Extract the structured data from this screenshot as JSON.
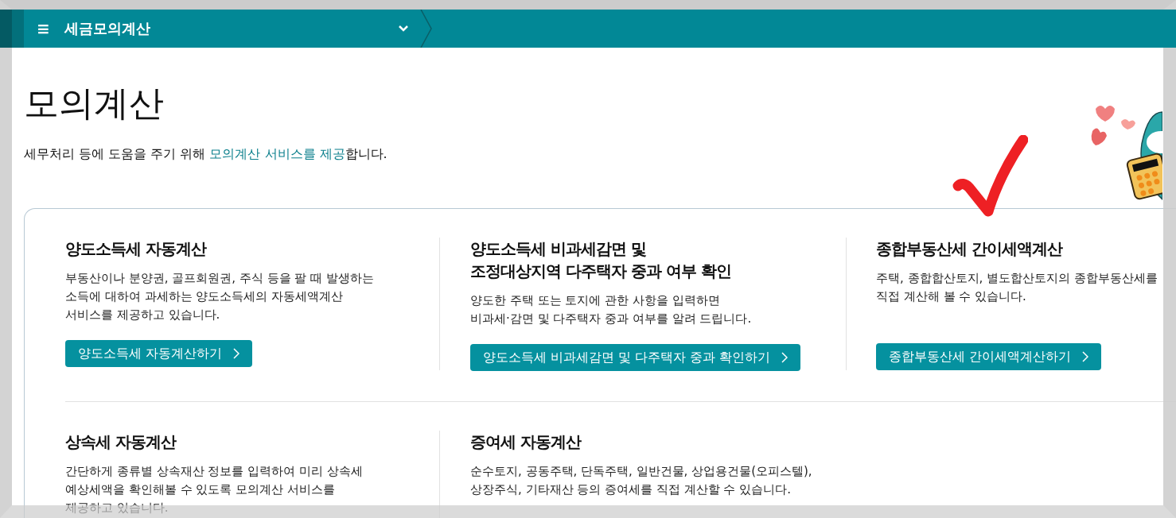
{
  "nav": {
    "menu_icon": "≡",
    "title": "세금모의계산"
  },
  "page": {
    "title": "모의계산",
    "intro": {
      "before": "세무처리 등에 도움을 주기 위해 ",
      "link": "모의계산 서비스를 제공",
      "after": "합니다."
    }
  },
  "services": [
    {
      "title": "양도소득세 자동계산",
      "description": "부동산이나 분양권, 골프회원권, 주식 등을 팔 때 발생하는\n소득에 대하여 과세하는 양도소득세의 자동세액계산\n서비스를 제공하고 있습니다.",
      "button": "양도소득세 자동계산하기"
    },
    {
      "title": "양도소득세 비과세감면 및\n조정대상지역 다주택자 중과 여부 확인",
      "description": "양도한 주택 또는 토지에 관한 사항을 입력하면\n비과세·감면 및 다주택자 중과 여부를 알려 드립니다.",
      "button": "양도소득세 비과세감면 및 다주택자 중과 확인하기"
    },
    {
      "title": "종합부동산세 간이세액계산",
      "description": "주택, 종합합산토지, 별도합산토지의 종합부동산세를 직접 계산해 볼 수 있습니다.",
      "button": "종합부동산세 간이세액계산하기"
    },
    {
      "title": "상속세 자동계산",
      "description": "간단하게 종류별 상속재산 정보를 입력하여 미리 상속세\n예상세액을 확인해볼 수 있도록 모의계산 서비스를\n제공하고 있습니다."
    },
    {
      "title": "증여세 자동계산",
      "description": "순수토지, 공동주택, 단독주택, 일반건물, 상업용건물(오피스텔),\n상장주식, 기타재산 등의 증여세를 직접 계산할 수 있습니다."
    }
  ]
}
